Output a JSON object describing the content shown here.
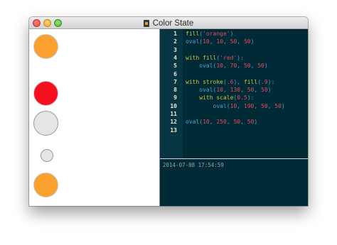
{
  "window": {
    "title": "Color State",
    "document_icon": "document-icon"
  },
  "canvas": {
    "shapes": [
      {
        "fill": "#f9a02e",
        "stroke": "#c9c9c9",
        "diameter": 50
      },
      {
        "fill": "#f5101e",
        "stroke": "#c9c9c9",
        "diameter": 50
      },
      {
        "fill": "#e5e5e5",
        "stroke": "#9a9a9a",
        "diameter": 50
      },
      {
        "fill": "#e5e5e5",
        "stroke": "#9a9a9a",
        "diameter": 25
      },
      {
        "fill": "#f9a02e",
        "stroke": "#c9c9c9",
        "diameter": 50
      }
    ]
  },
  "editor": {
    "lines": [
      {
        "n": "1",
        "tokens": [
          {
            "t": "fill",
            "c": "fn"
          },
          {
            "t": "(",
            "c": ""
          },
          {
            "t": "'orange'",
            "c": "str"
          },
          {
            "t": ")",
            "c": ""
          }
        ]
      },
      {
        "n": "2",
        "tokens": [
          {
            "t": "oval",
            "c": ""
          },
          {
            "t": "(",
            "c": ""
          },
          {
            "t": "10",
            "c": "num"
          },
          {
            "t": ", ",
            "c": ""
          },
          {
            "t": "10",
            "c": "num"
          },
          {
            "t": ", ",
            "c": ""
          },
          {
            "t": "50",
            "c": "num"
          },
          {
            "t": ", ",
            "c": ""
          },
          {
            "t": "50",
            "c": "num"
          },
          {
            "t": ")",
            "c": ""
          }
        ]
      },
      {
        "n": "3",
        "tokens": []
      },
      {
        "n": "4",
        "tokens": [
          {
            "t": "with ",
            "c": "kw"
          },
          {
            "t": "fill",
            "c": "fn"
          },
          {
            "t": "(",
            "c": ""
          },
          {
            "t": "'red'",
            "c": "str"
          },
          {
            "t": "):",
            "c": ""
          }
        ]
      },
      {
        "n": "5",
        "tokens": [
          {
            "t": "    oval",
            "c": ""
          },
          {
            "t": "(",
            "c": ""
          },
          {
            "t": "10",
            "c": "num"
          },
          {
            "t": ", ",
            "c": ""
          },
          {
            "t": "70",
            "c": "num"
          },
          {
            "t": ", ",
            "c": ""
          },
          {
            "t": "50",
            "c": "num"
          },
          {
            "t": ", ",
            "c": ""
          },
          {
            "t": "50",
            "c": "num"
          },
          {
            "t": ")",
            "c": ""
          }
        ]
      },
      {
        "n": "6",
        "tokens": []
      },
      {
        "n": "7",
        "tokens": [
          {
            "t": "with ",
            "c": "kw"
          },
          {
            "t": "stroke",
            "c": "fn"
          },
          {
            "t": "(",
            "c": ""
          },
          {
            "t": ".6",
            "c": "num"
          },
          {
            "t": "), ",
            "c": ""
          },
          {
            "t": "fill",
            "c": "fn"
          },
          {
            "t": "(",
            "c": ""
          },
          {
            "t": ".9",
            "c": "num"
          },
          {
            "t": "):",
            "c": ""
          }
        ]
      },
      {
        "n": "8",
        "tokens": [
          {
            "t": "    oval",
            "c": ""
          },
          {
            "t": "(",
            "c": ""
          },
          {
            "t": "10",
            "c": "num"
          },
          {
            "t": ", ",
            "c": ""
          },
          {
            "t": "130",
            "c": "num"
          },
          {
            "t": ", ",
            "c": ""
          },
          {
            "t": "50",
            "c": "num"
          },
          {
            "t": ", ",
            "c": ""
          },
          {
            "t": "50",
            "c": "num"
          },
          {
            "t": ")",
            "c": ""
          }
        ]
      },
      {
        "n": "9",
        "tokens": [
          {
            "t": "    with ",
            "c": "kw"
          },
          {
            "t": "scale",
            "c": "fn"
          },
          {
            "t": "(",
            "c": ""
          },
          {
            "t": "0.5",
            "c": "num"
          },
          {
            "t": "):",
            "c": ""
          }
        ]
      },
      {
        "n": "10",
        "tokens": [
          {
            "t": "        oval",
            "c": ""
          },
          {
            "t": "(",
            "c": ""
          },
          {
            "t": "10",
            "c": "num"
          },
          {
            "t": ", ",
            "c": ""
          },
          {
            "t": "190",
            "c": "num"
          },
          {
            "t": ", ",
            "c": ""
          },
          {
            "t": "50",
            "c": "num"
          },
          {
            "t": ", ",
            "c": ""
          },
          {
            "t": "50",
            "c": "num"
          },
          {
            "t": ")",
            "c": ""
          }
        ]
      },
      {
        "n": "11",
        "tokens": []
      },
      {
        "n": "12",
        "tokens": [
          {
            "t": "oval",
            "c": ""
          },
          {
            "t": "(",
            "c": ""
          },
          {
            "t": "10",
            "c": "num"
          },
          {
            "t": ", ",
            "c": ""
          },
          {
            "t": "250",
            "c": "num"
          },
          {
            "t": ", ",
            "c": ""
          },
          {
            "t": "50",
            "c": "num"
          },
          {
            "t": ", ",
            "c": ""
          },
          {
            "t": "50",
            "c": "num"
          },
          {
            "t": ")",
            "c": ""
          }
        ]
      },
      {
        "n": "13",
        "tokens": []
      }
    ]
  },
  "console": {
    "timestamp": "2014-07-08 17:54:59"
  },
  "colors": {
    "editor_bg": "#002b36",
    "gutter_bg": "#073642",
    "keyword": "#c8c73b",
    "string": "#e8495a",
    "plain": "#4aa0d0"
  }
}
